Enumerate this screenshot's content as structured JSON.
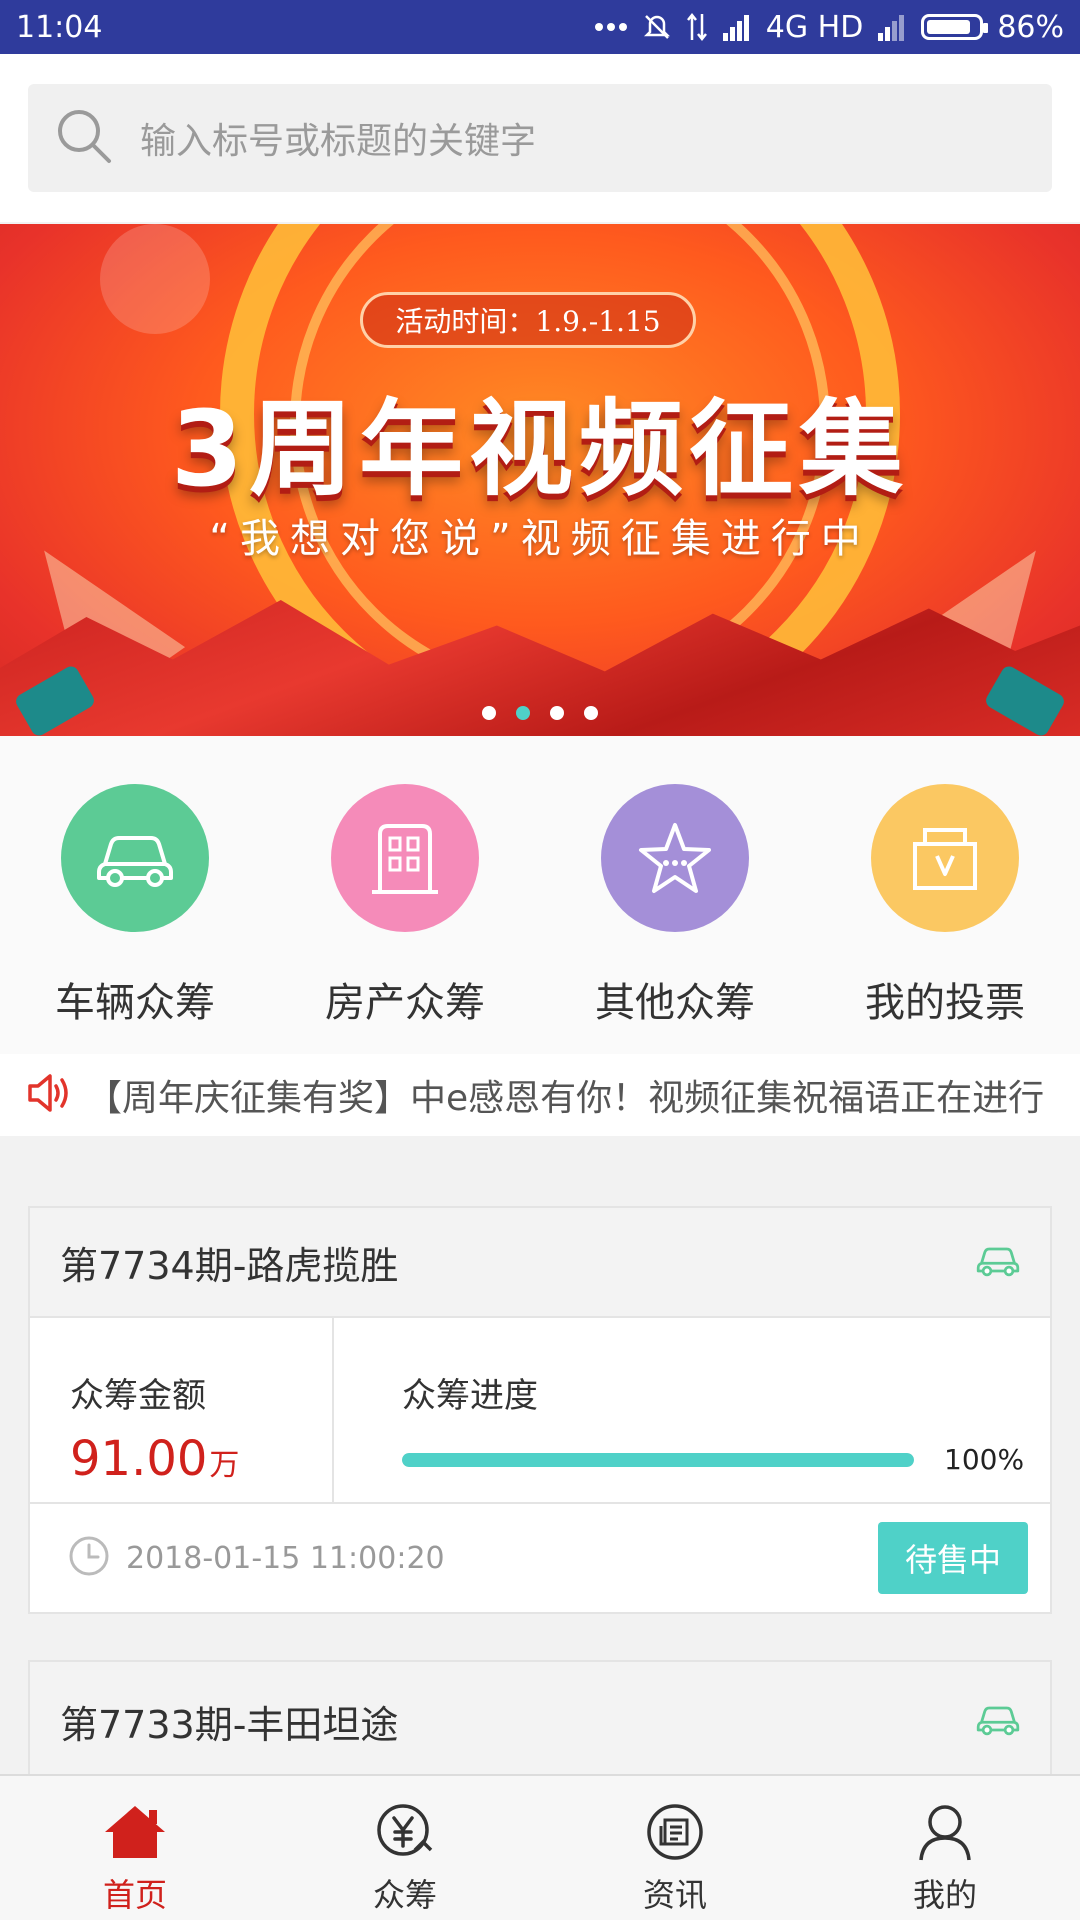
{
  "status_bar": {
    "time": "11:04",
    "network": "4G HD",
    "battery": "86%",
    "battery_level": 0.86
  },
  "search": {
    "placeholder": "输入标号或标题的关键字"
  },
  "banner": {
    "date_text": "活动时间：1.9.-1.15",
    "title": "3周年视频征集",
    "subtitle": "“我想对您说”视频征集进行中",
    "dots": 4,
    "active_dot": 1
  },
  "categories": [
    {
      "label": "车辆众筹",
      "icon": "car-icon",
      "color": "#5ccb95"
    },
    {
      "label": "房产众筹",
      "icon": "building-icon",
      "color": "#f58bb9"
    },
    {
      "label": "其他众筹",
      "icon": "star-icon",
      "color": "#a48fd8"
    },
    {
      "label": "我的投票",
      "icon": "vote-box-icon",
      "color": "#fbc862"
    }
  ],
  "notice": {
    "text": "【周年庆征集有奖】中e感恩有你！视频征集祝福语正在进行"
  },
  "cards": [
    {
      "title": "第7734期-路虎揽胜",
      "amount_label": "众筹金额",
      "amount": "91.00",
      "unit": "万",
      "progress_label": "众筹进度",
      "progress": 1.0,
      "progress_text": "100%",
      "time": "2018-01-15 11:00:20",
      "status": "待售中"
    },
    {
      "title": "第7733期-丰田坦途"
    }
  ],
  "nav": [
    {
      "label": "首页",
      "icon": "home-icon",
      "active": true
    },
    {
      "label": "众筹",
      "icon": "yen-icon",
      "active": false
    },
    {
      "label": "资讯",
      "icon": "news-icon",
      "active": false
    },
    {
      "label": "我的",
      "icon": "user-icon",
      "active": false
    }
  ],
  "colors": {
    "accent": "#4fd1c8",
    "brand_red": "#d0211c",
    "status_bar": "#2f3b9c"
  }
}
